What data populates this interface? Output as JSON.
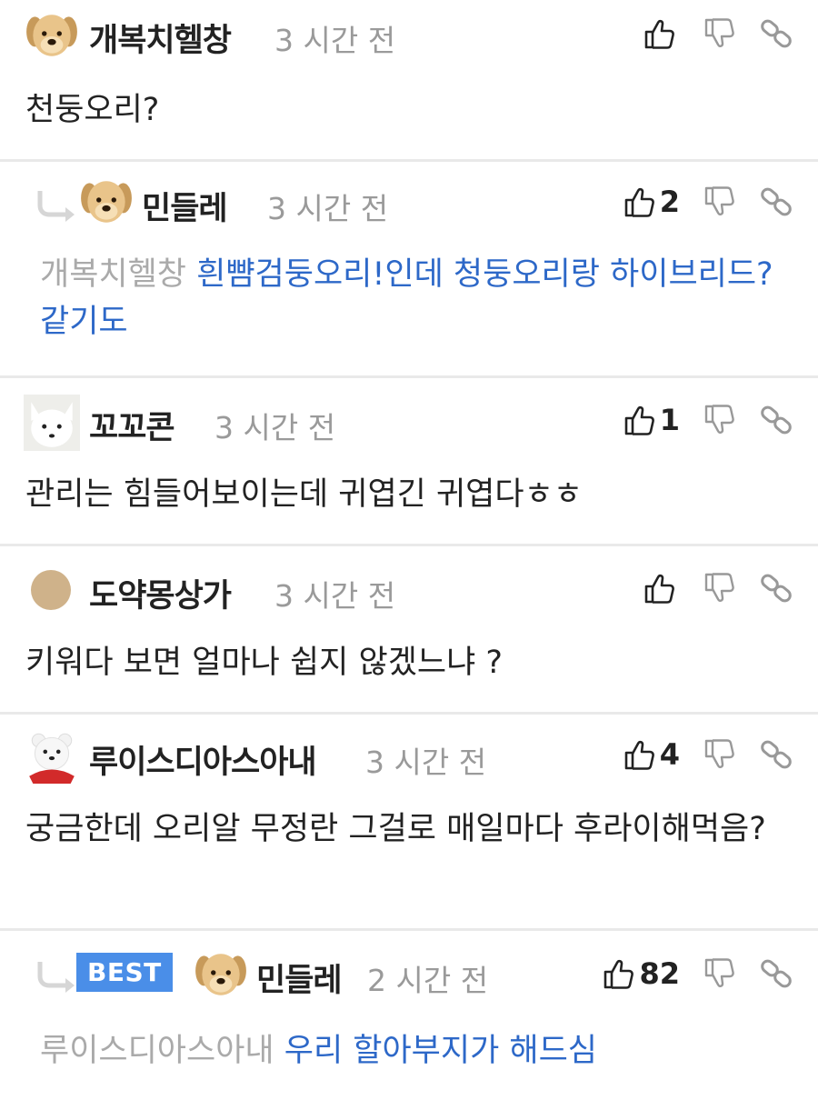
{
  "comments": [
    {
      "username": "개복치헬창",
      "time": "3 시간 전",
      "likes": "",
      "text": "천둥오리?",
      "avatar": "puppy-avatar"
    },
    {
      "username": "민들레",
      "time": "3 시간 전",
      "likes": "2",
      "mention": "개복치헬창",
      "text": "흰뺨검둥오리!인데 청둥오리랑 하이브리드?같기도",
      "avatar": "puppy-avatar"
    },
    {
      "username": "꼬꼬콘",
      "time": "3 시간 전",
      "likes": "1",
      "text": "관리는 힘들어보이는데 귀엽긴 귀엽다ㅎㅎ",
      "avatar": "white-fox-avatar"
    },
    {
      "username": "도약몽상가",
      "time": "3 시간 전",
      "likes": "",
      "text": "키워다 보면 얼마나 쉽지 않겠느냐 ?",
      "avatar": "tan-circle-avatar"
    },
    {
      "username": "루이스디아스아내",
      "time": "3 시간 전",
      "likes": "4",
      "text": "궁금한데 오리알 무정란 그걸로 매일마다 후라이해먹음?",
      "avatar": "white-bear-avatar"
    },
    {
      "badge": "BEST",
      "username": "민들레",
      "time": "2 시간 전",
      "likes": "82",
      "mention": "루이스디아스아내",
      "text": "우리 할아부지가 해드심",
      "avatar": "puppy-avatar"
    }
  ],
  "colors": {
    "link_blue": "#2d68c8",
    "mention_gray": "#aaaaaa",
    "time_gray": "#9a9a9a",
    "best_badge": "#4a8ee8",
    "separator": "#e9e9e9"
  },
  "icons": {
    "like": "thumbs-up-icon",
    "dislike": "thumbs-down-icon",
    "link": "link-icon",
    "reply": "reply-arrow-icon"
  }
}
